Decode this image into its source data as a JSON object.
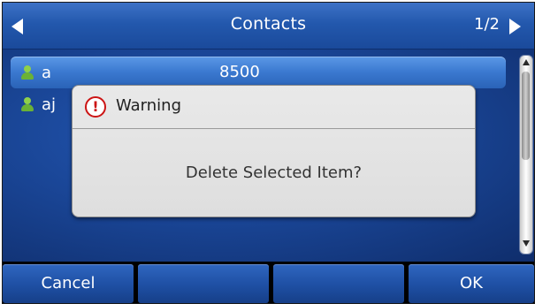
{
  "title_bar": {
    "title": "Contacts",
    "page_indicator": "1/2",
    "left_arrow_icon": "left-arrow-icon",
    "right_arrow_icon": "right-arrow-icon"
  },
  "contacts": [
    {
      "name": "a",
      "number": "8500",
      "selected": true,
      "icon": "person-icon"
    },
    {
      "name": "aj",
      "number": "",
      "selected": false,
      "icon": "person-icon"
    }
  ],
  "dialog": {
    "title": "Warning",
    "icon": "warning-icon",
    "message": "Delete Selected Item?"
  },
  "softkeys": [
    {
      "label": "Cancel"
    },
    {
      "label": ""
    },
    {
      "label": ""
    },
    {
      "label": "OK"
    }
  ],
  "colors": {
    "title_bar_blue": "#2358ad",
    "selected_row_blue": "#3a78cf",
    "dialog_gray": "#e3e3e3",
    "warning_red": "#cc1414",
    "contact_icon_green": "#6bb236"
  }
}
